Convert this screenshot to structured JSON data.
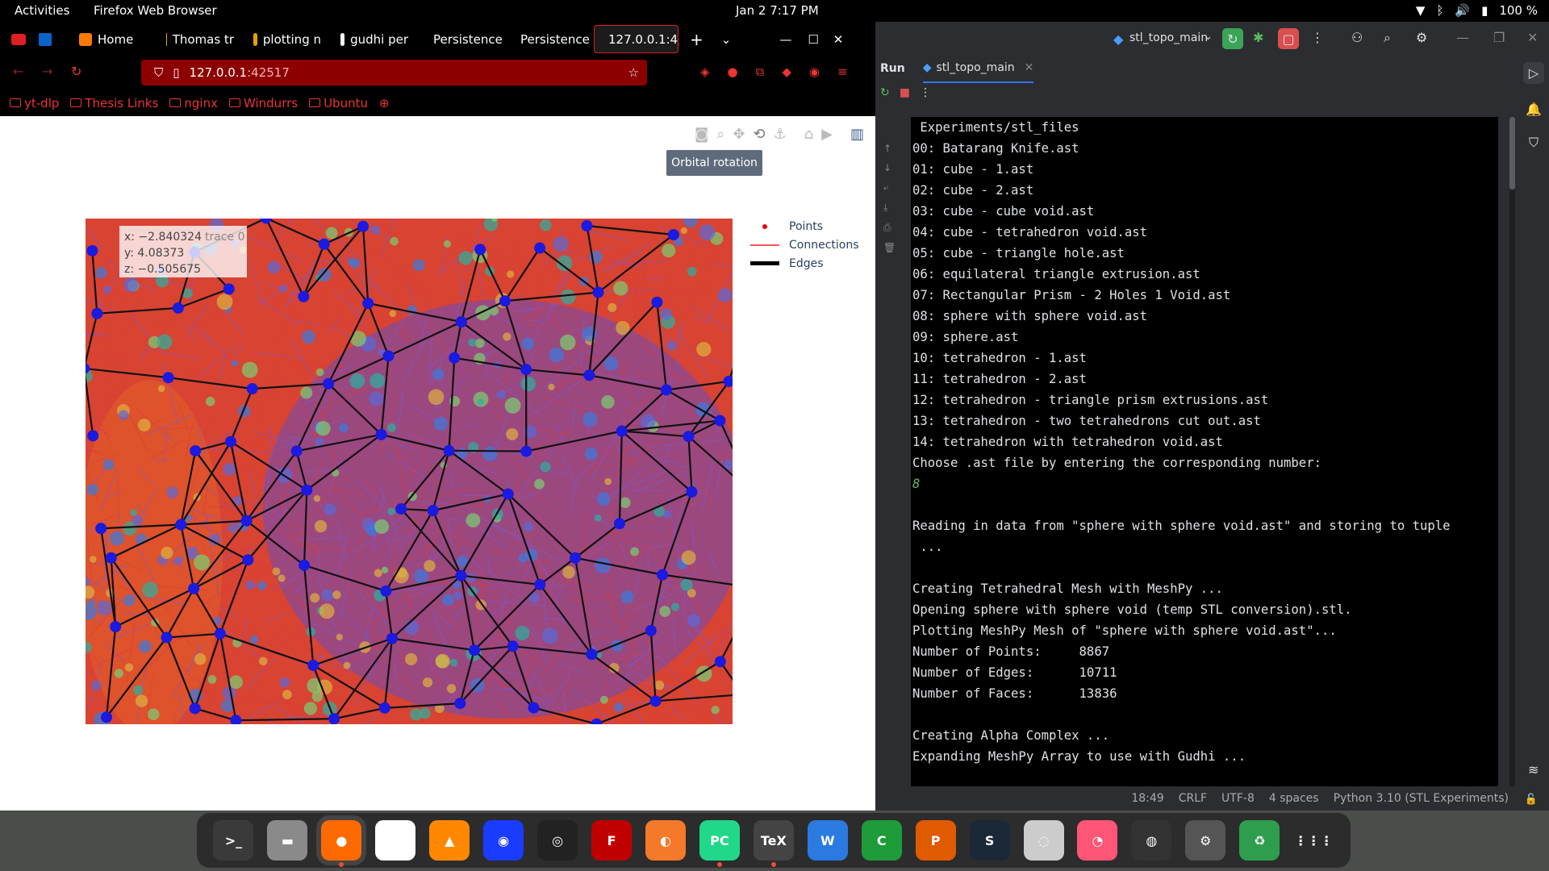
{
  "topbar": {
    "activities": "Activities",
    "app": "Firefox Web Browser",
    "clock": "Jan 2  7:17 PM",
    "battery": "100 %"
  },
  "firefox": {
    "tabs": [
      {
        "label": "Home",
        "color": "#ff7a00"
      },
      {
        "label": "Thomas tr",
        "color": "#e8a000"
      },
      {
        "label": "plotting n",
        "color": "#e8a000"
      },
      {
        "label": "gudhi per",
        "color": "#ffffff"
      },
      {
        "label": "Persistence g",
        "color": "#000000"
      },
      {
        "label": "Persistence g",
        "color": "#000000"
      },
      {
        "label": "127.0.0.1:4",
        "color": "#000000",
        "active": true
      }
    ],
    "url_host": "127.0.0.1",
    "url_port": ":42517",
    "bookmarks": [
      "yt-dlp",
      "Thesis Links",
      "nginx",
      "Windurrs",
      "Ubuntu"
    ],
    "tooltip": "Orbital rotation",
    "hover": {
      "x": "x: −2.840324",
      "y": "y: 4.08373",
      "z": "z: −0.505675",
      "trace": "trace 0"
    },
    "legend": [
      "Points",
      "Connections",
      "Edges"
    ]
  },
  "pycharm": {
    "config": "stl_topo_main",
    "run_label": "Run",
    "run_tab": "stl_topo_main",
    "console_lines": [
      {
        "t": " Experiments/stl_files"
      },
      {
        "t": "00: Batarang Knife.ast"
      },
      {
        "t": "01: cube - 1.ast"
      },
      {
        "t": "02: cube - 2.ast"
      },
      {
        "t": "03: cube - cube void.ast"
      },
      {
        "t": "04: cube - tetrahedron void.ast"
      },
      {
        "t": "05: cube - triangle hole.ast"
      },
      {
        "t": "06: equilateral triangle extrusion.ast"
      },
      {
        "t": "07: Rectangular Prism - 2 Holes 1 Void.ast"
      },
      {
        "t": "08: sphere with sphere void.ast"
      },
      {
        "t": "09: sphere.ast"
      },
      {
        "t": "10: tetrahedron - 1.ast"
      },
      {
        "t": "11: tetrahedron - 2.ast"
      },
      {
        "t": "12: tetrahedron - triangle prism extrusions.ast"
      },
      {
        "t": "13: tetrahedron - two tetrahedrons cut out.ast"
      },
      {
        "t": "14: tetrahedron with tetrahedron void.ast"
      },
      {
        "t": "Choose .ast file by entering the corresponding number:"
      },
      {
        "t": "8",
        "input": true
      },
      {
        "t": ""
      },
      {
        "t": "Reading in data from \"sphere with sphere void.ast\" and storing to tuple"
      },
      {
        "t": " ..."
      },
      {
        "t": ""
      },
      {
        "t": "Creating Tetrahedral Mesh with MeshPy ..."
      },
      {
        "t": "Opening sphere with sphere void (temp STL conversion).stl."
      },
      {
        "t": "Plotting MeshPy Mesh of \"sphere with sphere void.ast\"..."
      },
      {
        "t": "Number of Points:     8867"
      },
      {
        "t": "Number of Edges:      10711"
      },
      {
        "t": "Number of Faces:      13836"
      },
      {
        "t": ""
      },
      {
        "t": "Creating Alpha Complex ..."
      },
      {
        "t": "Expanding MeshPy Array to use with Gudhi ..."
      }
    ],
    "status": [
      "18:49",
      "CRLF",
      "UTF-8",
      "4 spaces",
      "Python 3.10 (STL Experiments)"
    ]
  },
  "dock": [
    {
      "name": "terminal",
      "label": ">_",
      "color": "#3a3a3a"
    },
    {
      "name": "files",
      "label": "▬",
      "color": "#8a8a8a"
    },
    {
      "name": "firefox",
      "label": "●",
      "color": "#ff6a00",
      "active": true
    },
    {
      "name": "text-editor",
      "label": "✎",
      "color": "#ffffff"
    },
    {
      "name": "vlc",
      "label": "▲",
      "color": "#ff8800"
    },
    {
      "name": "audacity",
      "label": "◉",
      "color": "#1a3cff"
    },
    {
      "name": "obs",
      "label": "◎",
      "color": "#222222"
    },
    {
      "name": "filezilla",
      "label": "F",
      "color": "#c00000"
    },
    {
      "name": "blender",
      "label": "◐",
      "color": "#f5792a"
    },
    {
      "name": "pycharm",
      "label": "PC",
      "color": "#21d789",
      "active": true
    },
    {
      "name": "texmaker",
      "label": "TeX",
      "color": "#444444",
      "active": true
    },
    {
      "name": "writer",
      "label": "W",
      "color": "#2a7ae2"
    },
    {
      "name": "calc",
      "label": "C",
      "color": "#1e9c3a"
    },
    {
      "name": "impress",
      "label": "P",
      "color": "#e05a00"
    },
    {
      "name": "steam",
      "label": "S",
      "color": "#1b2838"
    },
    {
      "name": "disks",
      "label": "◌",
      "color": "#cccccc"
    },
    {
      "name": "disk-usage",
      "label": "◔",
      "color": "#ff5577"
    },
    {
      "name": "camera",
      "label": "◍",
      "color": "#333333"
    },
    {
      "name": "settings",
      "label": "⚙",
      "color": "#555555"
    },
    {
      "name": "trash",
      "label": "♻",
      "color": "#2e9e4e"
    },
    {
      "name": "app-grid",
      "label": "⋮⋮⋮",
      "color": "#2c2c2c"
    }
  ]
}
